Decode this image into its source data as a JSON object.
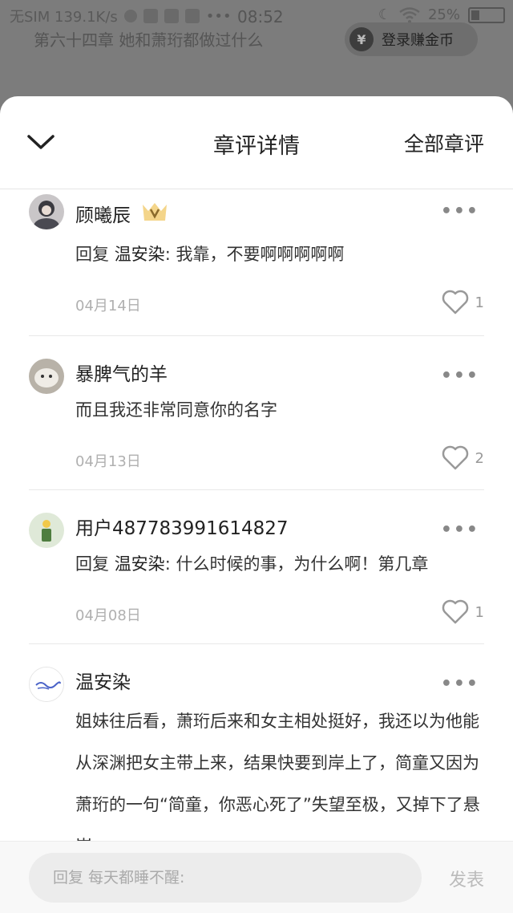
{
  "status_bar": {
    "carrier": "无SIM 139.1K/s",
    "time": "08:52",
    "battery": "25%"
  },
  "background": {
    "chapter_title": "第六十四章 她和萧珩都做过什么",
    "coin_button": "登录赚金币",
    "coin_symbol": "¥"
  },
  "sheet": {
    "title": "章评详情",
    "all_comments": "全部章评"
  },
  "comments": [
    {
      "username": "顾曦辰",
      "vip": true,
      "reply_prefix": "回复",
      "reply_to": "温安染",
      "text": ": 我靠，不要啊啊啊啊啊",
      "date": "04月14日",
      "likes": "1"
    },
    {
      "username": "暴脾气的羊",
      "text": "而且我还非常同意你的名字",
      "date": "04月13日",
      "likes": "2"
    },
    {
      "username": "用户487783991614827",
      "reply_prefix": "回复",
      "reply_to": "温安染",
      "text": ": 什么时候的事，为什么啊！第几章",
      "date": "04月08日",
      "likes": "1"
    },
    {
      "username": "温安染",
      "text": "姐妹往后看，萧珩后来和女主相处挺好，我还以为他能从深渊把女主带上来，结果快要到岸上了，简童又因为萧珩的一句“简童，你恶心死了”失望至极，又掉下了悬崖"
    }
  ],
  "more_glyph": "•••",
  "reply_bar": {
    "placeholder": "回复 每天都睡不醒:",
    "send_label": "发表"
  }
}
